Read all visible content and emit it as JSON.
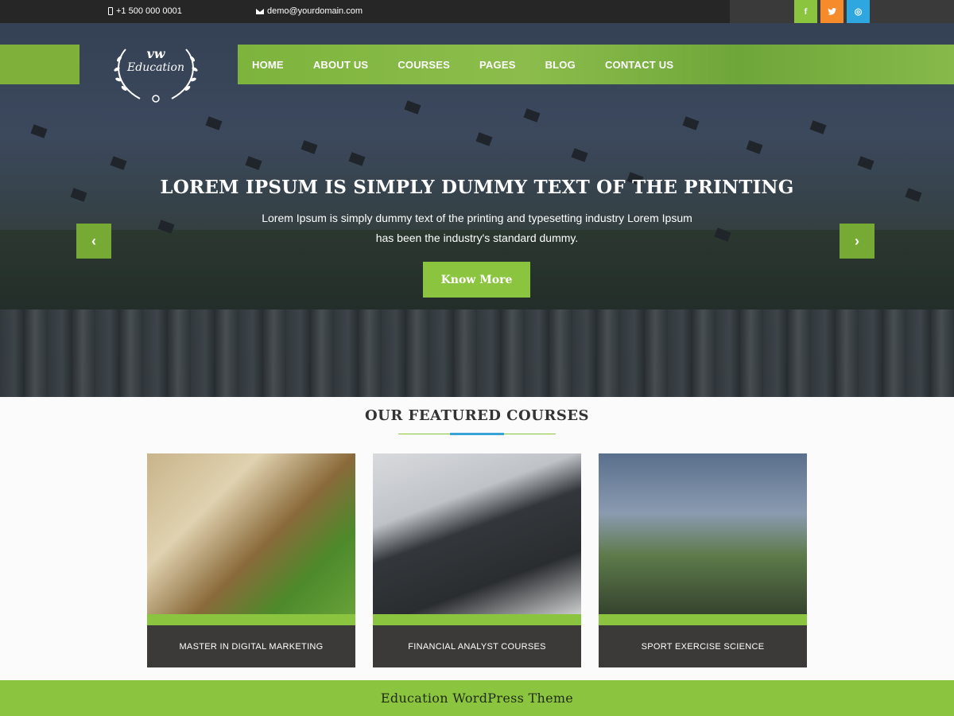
{
  "topbar": {
    "phone": "+1 500 000 0001",
    "email": "demo@yourdomain.com",
    "socials": [
      {
        "name": "facebook",
        "glyph": "f",
        "color": "#8bc53f"
      },
      {
        "name": "twitter",
        "glyph": "t",
        "color": "#f68b2c"
      },
      {
        "name": "instagram",
        "glyph": "◎",
        "color": "#2ea7e0"
      }
    ]
  },
  "logo": {
    "line1": "vw",
    "line2": "Education"
  },
  "nav": [
    "HOME",
    "ABOUT US",
    "COURSES",
    "PAGES",
    "BLOG",
    "CONTACT US"
  ],
  "slider": {
    "title": "LOREM IPSUM IS SIMPLY DUMMY TEXT OF THE PRINTING",
    "text": "Lorem Ipsum is simply dummy text of the printing and typesetting industry Lorem Ipsum has been the industry's standard dummy.",
    "button": "Know More",
    "prev": "‹",
    "next": "›"
  },
  "featured": {
    "title": "OUR FEATURED COURSES",
    "courses": [
      {
        "label": "MASTER IN DIGITAL MARKETING"
      },
      {
        "label": "FINANCIAL ANALYST COURSES"
      },
      {
        "label": "SPORT EXERCISE SCIENCE"
      }
    ]
  },
  "footer": {
    "text": "Education WordPress Theme"
  },
  "colors": {
    "accent": "#8bc53f",
    "dark": "#262626",
    "blue": "#38a3d6"
  }
}
